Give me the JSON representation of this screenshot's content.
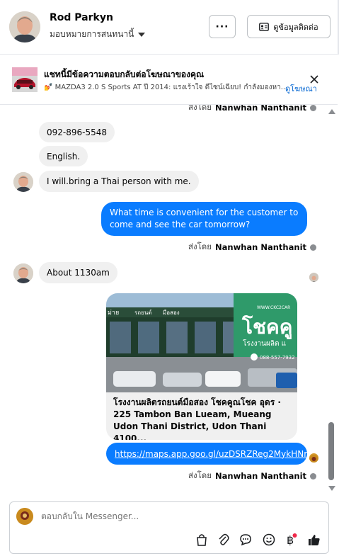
{
  "header": {
    "contact_name": "Rod Parkyn",
    "assign_label": "มอบหมายการสนทนานี้",
    "more_label": "···",
    "contact_info_label": "ดูข้อมูลติดต่อ"
  },
  "ad_banner": {
    "title": "แชทนี้มีข้อความตอบกลับต่อโฆษณาของคุณ",
    "subtitle": "💅 MAZDA3 2.0 S Sports AT ปี 2014: แรงเร้าใจ ดีไซน์เฉียบ! กำลังมองหา...",
    "link_label": "ดูโฆษณา"
  },
  "messages": {
    "top_sent_by_prefix": "ส่งโดย",
    "top_sent_by_name": "Nanwhan Nanthanit",
    "in_phone": "092-896-5548",
    "in_english": "English.",
    "in_thai_person": "I will.bring a Thai person with me.",
    "out_time_question": "What time is convenient for the customer to come and see the car tomorrow?",
    "sent_by_prefix": "ส่งโดย",
    "sent_by_name": "Nanwhan Nanthanit",
    "in_about_time": "About 1130am",
    "card_text": "โรงงานผลิตรถยนต์มือสอง โชคคูณโชค อุดร · 225 Tambon Ban Lueam, Mueang Udon Thani District, Udon Thani 4100...",
    "card_image_text": {
      "sign_brand": "โชคคู",
      "sign_sub": "โรงงานผลิต แ",
      "sign_site": "WWW.CKC2CAR",
      "sign_phone": "088-557-7932",
      "sign_left1": "รถยนต์",
      "sign_left2": "มือสอง",
      "sign_edge": "ม่าย"
    },
    "out_link": "https://maps.app.goo.gl/uzDSRZReg2MykHNr8",
    "bottom_sent_by_prefix": "ส่งโดย",
    "bottom_sent_by_name": "Nanwhan Nanthanit"
  },
  "composer": {
    "placeholder": "ตอบกลับใน Messenger...",
    "icons": [
      "bag-icon",
      "paperclip-icon",
      "speech-bubble-icon",
      "emoji-icon",
      "baht-icon",
      "thumbs-up-icon"
    ]
  },
  "colors": {
    "accent": "#0a7cff",
    "link": "#0064d1",
    "bubble_in": "#f0f0f0",
    "notification_dot": "#f02849"
  }
}
